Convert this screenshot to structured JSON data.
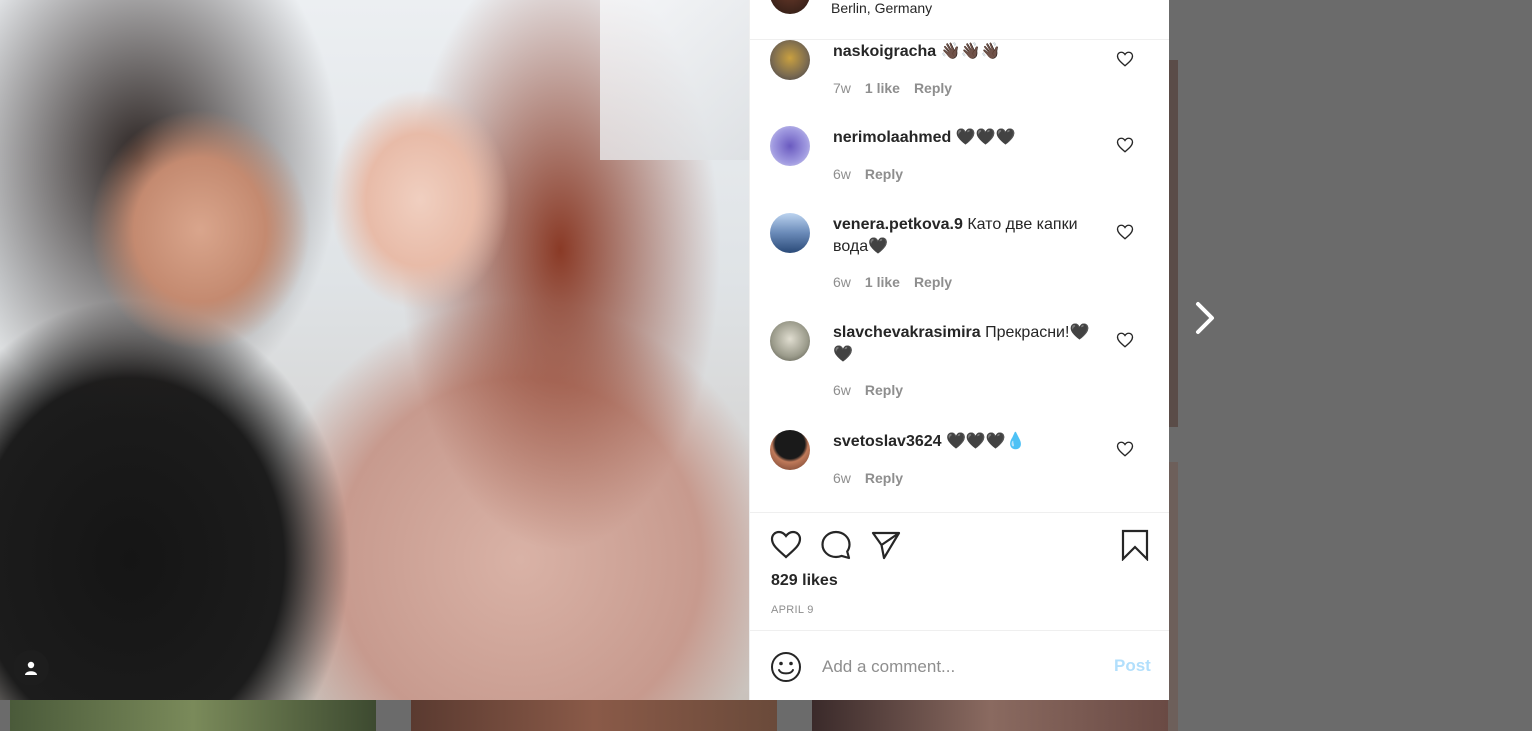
{
  "post": {
    "location": "Berlin, Germany",
    "likes_text": "829 likes",
    "date_text": "APRIL 9"
  },
  "comments": [
    {
      "username": "naskoigracha",
      "text": "👋🏿👋🏿👋🏿",
      "time": "7w",
      "likes": "1 like",
      "reply": "Reply",
      "avatar_color": "#7a6a50"
    },
    {
      "username": "nerimolaahmed",
      "text": "🖤🖤🖤",
      "time": "6w",
      "likes": "",
      "reply": "Reply",
      "avatar_color": "#8a7ad0"
    },
    {
      "username": "venera.petkova.9",
      "text": "Като две капки вода🖤",
      "time": "6w",
      "likes": "1 like",
      "reply": "Reply",
      "avatar_color": "#3a5a80"
    },
    {
      "username": "slavchevakrasimira",
      "text": "Прекрасни!🖤🖤",
      "time": "6w",
      "likes": "",
      "reply": "Reply",
      "avatar_color": "#8a8a7a"
    },
    {
      "username": "svetoslav3624",
      "text": "🖤🖤🖤💧",
      "time": "6w",
      "likes": "",
      "reply": "Reply",
      "avatar_color": "#5a3a2a"
    }
  ],
  "add_comment": {
    "placeholder": "Add a comment...",
    "post_label": "Post"
  },
  "colors": {
    "link_disabled": "#b2dffc",
    "muted": "#8e8e8e",
    "text": "#262626"
  }
}
